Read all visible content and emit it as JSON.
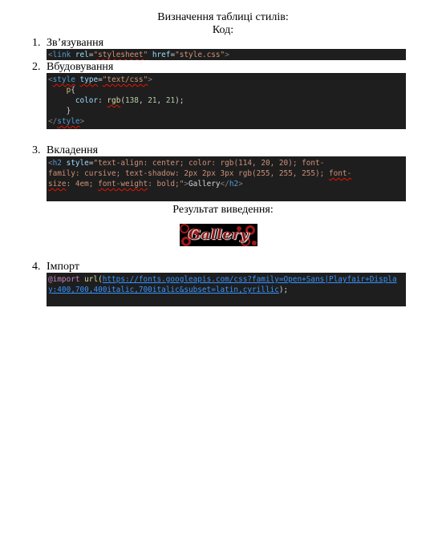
{
  "header": {
    "title": "Визначення таблиці стилів:",
    "subtitle": "Код:"
  },
  "items": [
    {
      "number": "1.",
      "label": "Зв’язування",
      "code": [
        [
          "<",
          "link",
          " ",
          "rel",
          "=",
          "\"stylesheet\"",
          " ",
          "href",
          "=",
          "\"style.css\"",
          ">"
        ]
      ]
    },
    {
      "number": "2.",
      "label": "Вбудовування",
      "code": {
        "line1": [
          "<",
          "style",
          " ",
          "type",
          "=",
          "\"text/css\"",
          ">"
        ],
        "line2": [
          "    ",
          "p",
          "{"
        ],
        "line3": [
          "      ",
          "color",
          ": ",
          "rgb",
          "(",
          "138",
          ", ",
          "21",
          ", ",
          "21",
          ");"
        ],
        "line4": [
          "    }"
        ],
        "line5": [
          "</",
          "style",
          ">"
        ]
      }
    },
    {
      "number": "3.",
      "label": "Вкладення",
      "code": {
        "line1a": "<",
        "line1b": "h2",
        "line1c": " style",
        "line1d": "=",
        "line1e": "\"text-align: center; color: rgb(114, 20, 20); font-",
        "line2a": "family: cursive; text-shadow: 2px 2px 3px rgb(255, 255, 255); ",
        "line2b": "font-",
        "line3a": "size",
        "line3b": ": 4em; ",
        "line3c": "font-weight",
        "line3d": ": bold;\"",
        "line3e": ">",
        "line3f": "Gallery",
        "line3g": "</",
        "line3h": "h2",
        "line3i": ">"
      }
    },
    {
      "number": "4.",
      "label": "Імпорт",
      "code": {
        "at": "@import",
        "fn": " url(",
        "url1": "https://fonts.googleapis.com/css?family=Open+Sans|Playfair+Displa",
        "url2": "y:400,700,400italic,700italic&subset=latin,cyrillic",
        "end": ");"
      }
    }
  ],
  "result": {
    "label": "Результат виведення:",
    "gallery_text": "Gallery"
  },
  "colors": {
    "code_background": "#1e1e1e",
    "gallery_text": "#8a1515",
    "gallery_background": "#000000"
  }
}
